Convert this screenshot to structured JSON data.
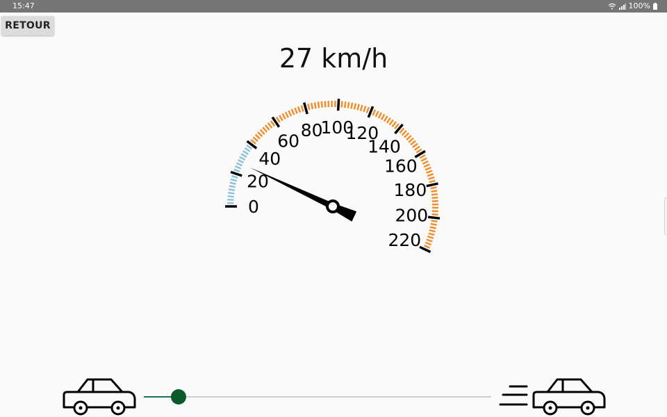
{
  "status_bar": {
    "time": "15:47",
    "battery": "100%",
    "icons": [
      "wifi-icon",
      "signal-icon",
      "battery-icon"
    ]
  },
  "toolbar": {
    "back_label": "RETOUR"
  },
  "speed": {
    "readout": "27 km/h",
    "value": 27
  },
  "gauge": {
    "min": 0,
    "max": 220,
    "major_step": 20,
    "labels": [
      "0",
      "20",
      "40",
      "60",
      "80",
      "100",
      "120",
      "140",
      "160",
      "180",
      "200",
      "220"
    ],
    "colors": {
      "low": "#8fc1d9",
      "high": "#ee8f2e",
      "major": "#000000",
      "needle": "#000000"
    },
    "low_zone_max": 40
  },
  "slider": {
    "value_fraction": 0.1
  },
  "icons": {
    "slow": "car-icon",
    "fast": "fast-car-icon"
  }
}
